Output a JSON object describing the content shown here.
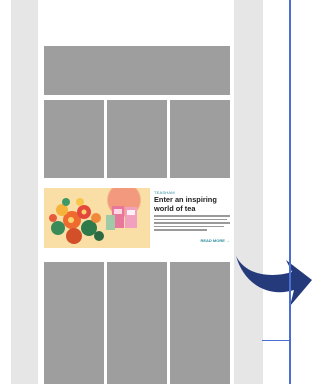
{
  "promo": {
    "eyebrow": "TEASHAM",
    "headline": "Enter an inspiring world of tea",
    "cta": "READ MORE →"
  },
  "colors": {
    "placeholder": "#9e9e9e",
    "gutter": "#e6e6e6",
    "accent_teal": "#2a8a9b",
    "arrow_navy": "#243a7a",
    "rule_blue": "#4a6fd1"
  },
  "icons": {
    "arrow": "curved-arrow-right-icon"
  }
}
